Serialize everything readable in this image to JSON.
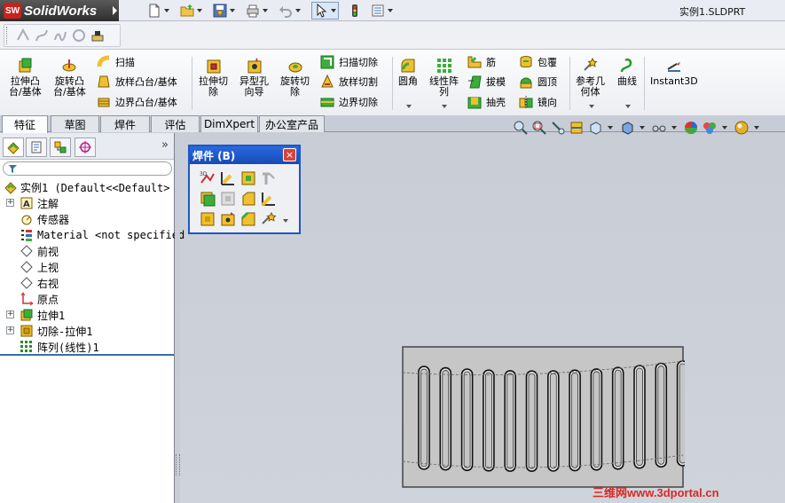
{
  "app": {
    "logo_text": "SolidWorks",
    "logo_badge": "SW",
    "document_title": "实例1.SLDPRT"
  },
  "quick_access": [
    {
      "icon": "new-document-icon"
    },
    {
      "icon": "open-folder-icon"
    },
    {
      "icon": "save-icon"
    },
    {
      "icon": "print-icon"
    },
    {
      "icon": "undo-icon"
    },
    {
      "icon": "select-arrow-icon"
    },
    {
      "icon": "traffic-light-rebuild-icon"
    },
    {
      "icon": "options-icon"
    }
  ],
  "command_manager": {
    "features": {
      "extruded_boss": "拉伸凸\n台/基体",
      "revolved_boss": "旋转凸\n台/基体",
      "sweep": "扫描",
      "loft": "放样凸台/基体",
      "boundary": "边界凸台/基体",
      "extruded_cut": "拉伸切\n除",
      "hole_wizard": "异型孔\n向导",
      "revolved_cut": "旋转切\n除",
      "swept_cut": "扫描切除",
      "lofted_cut": "放样切割",
      "boundary_cut": "边界切除",
      "fillet": "圆角",
      "linear_pattern": "线性阵\n列",
      "rib": "筋",
      "draft": "拔模",
      "shell": "抽壳",
      "wrap": "包覆",
      "dome": "圆顶",
      "mirror": "镜向",
      "reference_geometry": "参考几\n何体",
      "curves": "曲线",
      "instant3d": "Instant3D"
    }
  },
  "tabs": [
    "特征",
    "草图",
    "焊件",
    "评估",
    "DimXpert",
    "办公室产品"
  ],
  "active_tab": "特征",
  "panel": {
    "more": "»"
  },
  "tree": [
    {
      "label": "实例1  (Default<<Default>",
      "icon": "part-icon",
      "expandable": false
    },
    {
      "label": "注解",
      "icon": "annotations-icon",
      "expandable": true
    },
    {
      "label": "传感器",
      "icon": "sensors-icon",
      "expandable": false
    },
    {
      "label": "Material <not specified",
      "icon": "material-icon",
      "expandable": false
    },
    {
      "label": "前视",
      "icon": "plane-icon",
      "expandable": false
    },
    {
      "label": "上视",
      "icon": "plane-icon",
      "expandable": false
    },
    {
      "label": "右视",
      "icon": "plane-icon",
      "expandable": false
    },
    {
      "label": "原点",
      "icon": "origin-icon",
      "expandable": false
    },
    {
      "label": "拉伸1",
      "icon": "extrude-icon",
      "expandable": true
    },
    {
      "label": "切除-拉伸1",
      "icon": "cut-extrude-icon",
      "expandable": true
    },
    {
      "label": "阵列(线性)1",
      "icon": "linear-pattern-icon",
      "expandable": false
    }
  ],
  "weldments_toolbar": {
    "title": "焊件 (B)",
    "close_glyph": "×"
  },
  "watermark": "三维网www.3dportal.cn",
  "colors": {
    "titlebar_blue": "#1f56c4",
    "viewport_bg": "#c8cdd6",
    "part_face": "#c6c6c6",
    "watermark_red": "#d62a24"
  }
}
